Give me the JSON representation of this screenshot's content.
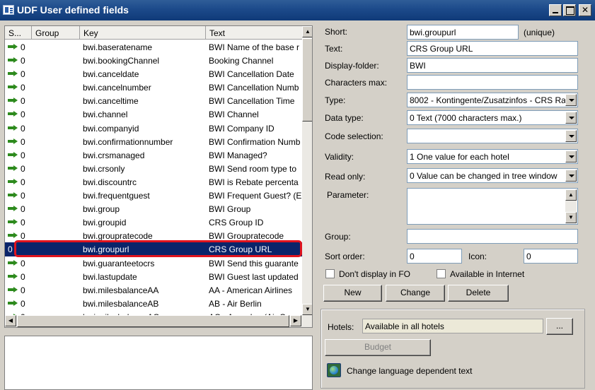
{
  "window": {
    "title": "UDF User defined fields"
  },
  "list": {
    "columns": [
      "S...",
      "Group",
      "Key",
      "Text"
    ],
    "rows": [
      {
        "status": "0",
        "group": "",
        "key": "bwi.baseratename",
        "text": "BWI Name of the base r"
      },
      {
        "status": "0",
        "group": "",
        "key": "bwi.bookingChannel",
        "text": "Booking Channel"
      },
      {
        "status": "0",
        "group": "",
        "key": "bwi.canceldate",
        "text": "BWI Cancellation Date"
      },
      {
        "status": "0",
        "group": "",
        "key": "bwi.cancelnumber",
        "text": "BWI Cancellation Numb"
      },
      {
        "status": "0",
        "group": "",
        "key": "bwi.canceltime",
        "text": "BWI Cancellation Time"
      },
      {
        "status": "0",
        "group": "",
        "key": "bwi.channel",
        "text": "BWI Channel"
      },
      {
        "status": "0",
        "group": "",
        "key": "bwi.companyid",
        "text": "BWI Company ID"
      },
      {
        "status": "0",
        "group": "",
        "key": "bwi.confirmationnumber",
        "text": "BWI Confirmation Numb"
      },
      {
        "status": "0",
        "group": "",
        "key": "bwi.crsmanaged",
        "text": "BWI Managed?"
      },
      {
        "status": "0",
        "group": "",
        "key": "bwi.crsonly",
        "text": "BWI Send room type to"
      },
      {
        "status": "0",
        "group": "",
        "key": "bwi.discountrc",
        "text": "BWI is Rebate percenta"
      },
      {
        "status": "0",
        "group": "",
        "key": "bwi.frequentguest",
        "text": "BWI Frequent Guest? (E"
      },
      {
        "status": "0",
        "group": "",
        "key": "bwi.group",
        "text": "BWI Group"
      },
      {
        "status": "0",
        "group": "",
        "key": "bwi.groupid",
        "text": "CRS Group ID"
      },
      {
        "status": "0",
        "group": "",
        "key": "bwi.groupratecode",
        "text": "BWI Groupratecode"
      },
      {
        "status": "0",
        "group": "",
        "key": "bwi.groupurl",
        "text": "CRS Group URL",
        "selected": true
      },
      {
        "status": "0",
        "group": "",
        "key": "bwi.guaranteetocrs",
        "text": "BWI Send this guarante"
      },
      {
        "status": "0",
        "group": "",
        "key": "bwi.lastupdate",
        "text": "BWI Guest last updated"
      },
      {
        "status": "0",
        "group": "",
        "key": "bwi.milesbalanceAA",
        "text": "AA - American Airlines"
      },
      {
        "status": "0",
        "group": "",
        "key": "bwi.milesbalanceAB",
        "text": "AB - Air Berlin"
      },
      {
        "status": "0",
        "group": "",
        "key": "bwi.milesbalanceAC",
        "text": "AC - Aeroplan (Air Cana"
      }
    ]
  },
  "form": {
    "short_label": "Short:",
    "short_value": "bwi.groupurl",
    "unique_note": "(unique)",
    "text_label": "Text:",
    "text_value": "CRS Group URL",
    "folder_label": "Display-folder:",
    "folder_value": "BWI",
    "chars_label": "Characters max:",
    "chars_value": "",
    "type_label": "Type:",
    "type_value": "8002 - Kontingente/Zusatzinfos - CRS Ra",
    "datatype_label": "Data type:",
    "datatype_value": "0 Text (7000 characters max.)",
    "codesel_label": "Code selection:",
    "codesel_value": "",
    "validity_label": "Validity:",
    "validity_value": "1 One value for each hotel",
    "readonly_label": "Read only:",
    "readonly_value": "0 Value can be changed in tree window",
    "parameter_label": "Parameter:",
    "group_label": "Group:",
    "group_value": "",
    "sort_label": "Sort order:",
    "sort_value": "0",
    "icon_label": "Icon:",
    "icon_value": "0",
    "no_display_label": "Don't display in FO",
    "internet_label": "Available in Internet",
    "new_button": "New",
    "change_button": "Change",
    "delete_button": "Delete"
  },
  "hotels": {
    "label": "Hotels:",
    "value": "Available in all hotels",
    "browse_button": "...",
    "budget_button": "Budget",
    "language_link": "Change language dependent text"
  }
}
